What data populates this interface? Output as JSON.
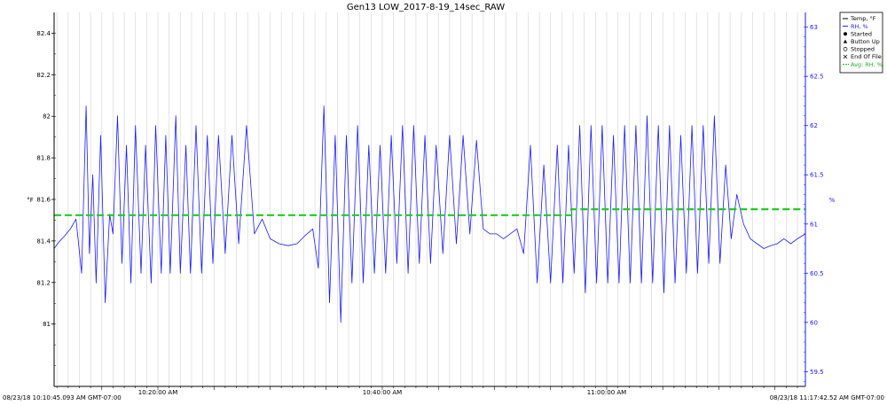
{
  "chart_data": {
    "type": "line",
    "title": "Gen13 LOW_2017-8-19_14sec_RAW",
    "left_axis": {
      "label": "°F",
      "ylim": [
        80.7,
        82.5
      ],
      "ticks": [
        81,
        81.2,
        81.4,
        81.6,
        81.8,
        82,
        82.2,
        82.4
      ],
      "tick_labels": [
        "81",
        "81.2",
        "81.4",
        "81.6",
        "81.8",
        "82",
        "82.2",
        "82.4"
      ]
    },
    "right_axis": {
      "label": "%",
      "color": "#1a1aff",
      "ylim": [
        59.35,
        63.15
      ],
      "ticks": [
        59.5,
        60,
        60.5,
        61,
        61.5,
        62,
        62.5,
        63
      ],
      "tick_labels": [
        "59.5",
        "60",
        "60.5",
        "61",
        "61.5",
        "62",
        "62.5",
        "63"
      ]
    },
    "x_axis": {
      "start_label": "08/23/18 10:10:45.093 AM GMT-07:00",
      "end_label": "08/23/18 11:17:42.52 AM GMT-07:00",
      "start_minutes": 10.75,
      "end_minutes": 77.71,
      "tick_minutes": [
        20,
        40,
        60
      ],
      "tick_labels": [
        "10:20:00 AM",
        "10:40:00 AM",
        "11:00:00 AM"
      ]
    },
    "grid": true,
    "legend": {
      "placement": "top-right",
      "entries": [
        {
          "label": "Temp, °F",
          "marker": "line",
          "color": "#000000"
        },
        {
          "label": "RH, %",
          "marker": "line",
          "color": "#1a1aff"
        },
        {
          "label": "Started",
          "marker": "filled-circle",
          "color": "#000000"
        },
        {
          "label": "Button Up",
          "marker": "filled-triangle",
          "color": "#000000"
        },
        {
          "label": "Stopped",
          "marker": "open-circle",
          "color": "#000000"
        },
        {
          "label": "End Of File",
          "marker": "cross",
          "color": "#000000"
        },
        {
          "label": "Avg: RH, %",
          "marker": "dashed",
          "color": "#22cc22"
        }
      ]
    },
    "series": [
      {
        "name": "RH, %",
        "axis": "right",
        "color": "#1a1aff",
        "x": [
          10.75,
          11.2,
          11.7,
          12.2,
          12.7,
          13.2,
          13.6,
          13.9,
          14.2,
          14.5,
          14.9,
          15.3,
          15.7,
          16.0,
          16.4,
          16.8,
          17.2,
          17.6,
          18.0,
          18.5,
          18.9,
          19.4,
          19.8,
          20.3,
          20.7,
          21.1,
          21.6,
          22.0,
          22.5,
          22.9,
          23.4,
          23.9,
          24.4,
          24.9,
          25.4,
          26.0,
          26.6,
          27.2,
          27.9,
          28.6,
          29.3,
          30.0,
          30.8,
          31.6,
          32.4,
          33.1,
          33.8,
          34.3,
          34.8,
          35.3,
          35.8,
          36.3,
          36.8,
          37.3,
          37.8,
          38.3,
          38.8,
          39.3,
          39.8,
          40.3,
          40.8,
          41.3,
          41.8,
          42.3,
          42.8,
          43.3,
          43.8,
          44.3,
          44.8,
          45.4,
          46.0,
          46.6,
          47.2,
          47.8,
          48.4,
          49.0,
          49.6,
          50.2,
          50.8,
          51.4,
          52.0,
          52.6,
          53.2,
          53.8,
          54.4,
          55.0,
          55.6,
          56.1,
          56.6,
          57.1,
          57.6,
          58.1,
          58.6,
          59.1,
          59.6,
          60.1,
          60.6,
          61.1,
          61.6,
          62.1,
          62.6,
          63.1,
          63.6,
          64.1,
          64.6,
          65.1,
          65.6,
          66.1,
          66.6,
          67.1,
          67.6,
          68.1,
          68.6,
          69.1,
          69.6,
          70.1,
          70.6,
          71.1,
          71.6,
          72.2,
          72.8,
          73.4,
          74.0,
          74.6,
          75.2,
          75.8,
          76.4,
          77.0,
          77.71
        ],
        "y": [
          60.75,
          60.82,
          60.88,
          60.95,
          61.05,
          60.5,
          62.2,
          60.7,
          61.5,
          60.4,
          61.9,
          60.2,
          61.1,
          60.9,
          62.1,
          60.6,
          61.8,
          60.4,
          62.0,
          60.5,
          61.8,
          60.4,
          62.0,
          60.5,
          61.9,
          60.5,
          62.1,
          60.5,
          61.8,
          60.5,
          62.0,
          60.5,
          61.9,
          60.6,
          61.9,
          60.7,
          61.9,
          60.8,
          62.0,
          60.9,
          61.05,
          60.85,
          60.8,
          60.78,
          60.8,
          60.88,
          60.95,
          60.55,
          62.2,
          60.2,
          61.9,
          60.0,
          61.9,
          60.4,
          62.0,
          60.4,
          61.8,
          60.5,
          61.8,
          60.5,
          61.9,
          60.6,
          62.0,
          60.5,
          62.0,
          60.6,
          61.9,
          60.6,
          61.8,
          60.7,
          61.9,
          60.8,
          61.9,
          60.9,
          61.85,
          60.95,
          60.9,
          60.9,
          60.85,
          60.9,
          60.95,
          60.7,
          61.8,
          60.4,
          61.6,
          60.4,
          61.8,
          60.4,
          61.8,
          60.5,
          62.0,
          60.3,
          62.0,
          60.4,
          62.0,
          60.4,
          61.9,
          60.4,
          62.0,
          60.4,
          62.0,
          60.4,
          62.1,
          60.4,
          62.0,
          60.3,
          62.0,
          60.4,
          61.9,
          60.5,
          62.0,
          60.5,
          62.0,
          60.6,
          62.1,
          60.6,
          61.6,
          60.85,
          61.3,
          61.0,
          60.85,
          60.8,
          60.75,
          60.78,
          60.8,
          60.85,
          60.8,
          60.85,
          60.9
        ]
      },
      {
        "name": "Avg: RH, %",
        "axis": "right",
        "color": "#22cc22",
        "style": "dashed",
        "x": [
          10.75,
          56.85,
          56.85,
          77.71
        ],
        "y": [
          61.09,
          61.09,
          61.15,
          61.15
        ]
      }
    ]
  }
}
